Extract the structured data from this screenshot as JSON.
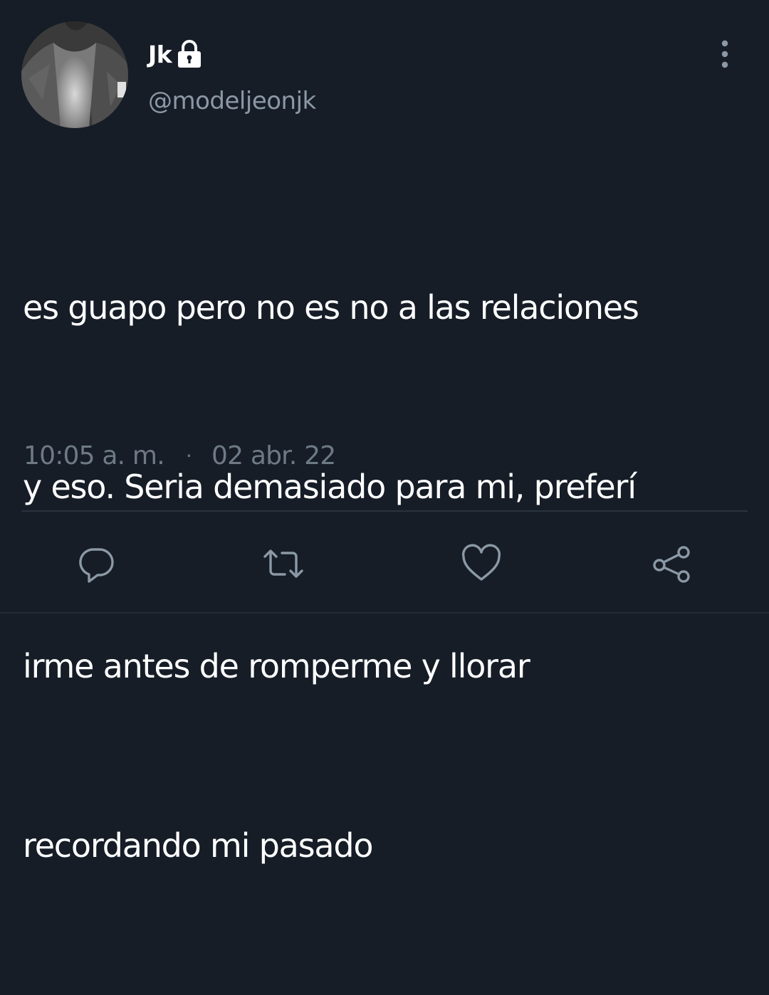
{
  "user": {
    "display_name": "Jk",
    "handle": "@modeljeonjk",
    "protected_icon": "lock-icon",
    "avatar": "user-avatar"
  },
  "tweet": {
    "text_lines": [
      "es guapo pero no es no a las relaciones",
      "y eso. Seria demasiado para mi, preferí",
      "irme antes de romperme y llorar",
      "recordando mi pasado"
    ],
    "time": "10:05 a. m.",
    "separator": "·",
    "date": "02 abr. 22"
  },
  "actions": [
    {
      "icon": "reply-icon"
    },
    {
      "icon": "retweet-icon"
    },
    {
      "icon": "like-icon"
    },
    {
      "icon": "share-icon"
    }
  ],
  "colors": {
    "background": "#161d27",
    "text": "#ffffff",
    "secondary": "#8b98a5",
    "divider": "#2b343e"
  }
}
